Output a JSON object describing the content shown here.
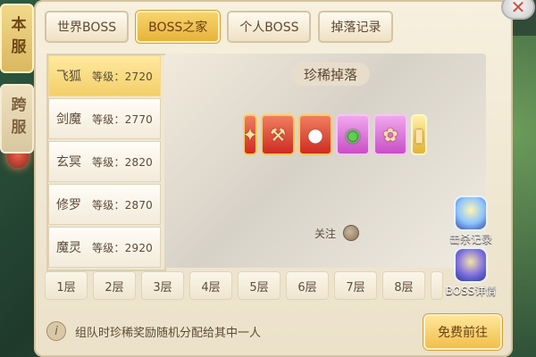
{
  "side_tabs": [
    "本服",
    "跨服"
  ],
  "top_tabs": [
    {
      "label": "世界BOSS",
      "active": false
    },
    {
      "label": "BOSS之家",
      "active": true
    },
    {
      "label": "个人BOSS",
      "active": false
    },
    {
      "label": "掉落记录",
      "active": false
    }
  ],
  "bosses": [
    {
      "name": "飞狐",
      "level": "等级：2720",
      "selected": true
    },
    {
      "name": "剑魔",
      "level": "等级：2770",
      "selected": false
    },
    {
      "name": "玄冥",
      "level": "等级：2820",
      "selected": false
    },
    {
      "name": "修罗",
      "level": "等级：2870",
      "selected": false
    },
    {
      "name": "魔灵",
      "level": "等级：2920",
      "selected": false
    }
  ],
  "drops_title": "珍稀掉落",
  "follow_label": "关注",
  "right_actions": [
    {
      "label": "击杀记录",
      "icon": "crossed-swords-icon"
    },
    {
      "label": "BOSS详情",
      "icon": "boss-mask-icon"
    }
  ],
  "floors": [
    "1层",
    "2层",
    "3层",
    "4层",
    "5层",
    "6层",
    "7层",
    "8层"
  ],
  "info_text": "组队时珍稀奖励随机分配给其中一人",
  "free_button_label": "免费前往"
}
